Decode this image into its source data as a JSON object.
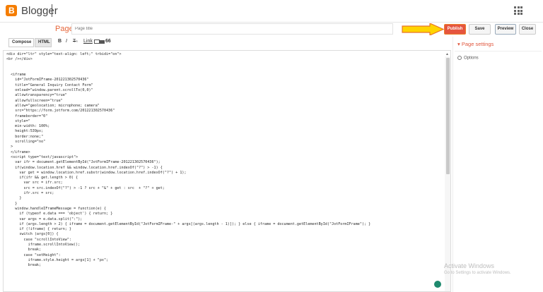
{
  "header": {
    "app_title": "Blogger",
    "logo_letter": "B"
  },
  "post": {
    "page_label": "Page",
    "title_placeholder": "Page title"
  },
  "actions": {
    "publish": "Publish",
    "save": "Save",
    "preview": "Preview",
    "close": "Close"
  },
  "toolbar": {
    "compose_tab": "Compose",
    "html_tab": "HTML",
    "bold": "B",
    "italic": "I",
    "strike": "T",
    "text_size": "₄₀",
    "link": "Link",
    "quote": "66"
  },
  "sidebar": {
    "page_settings": "Page settings",
    "options": "Options"
  },
  "editor": {
    "code": "<div dir=\"ltr\" style=\"text-align: left;\" trbidi=\"on\">\n<br /></div>\n\n\n  <iframe\n    id=\"JotFormIFrame-201221302570436\"\n    title=\"General Inquiry Contact Form\"\n    onload=\"window.parent.scrollTo(0,0)\"\n    allowtransparency=\"true\"\n    allowfullscreen=\"true\"\n    allow=\"geolocation; microphone; camera\"\n    src=\"https://form.jotform.com/201221302570436\"\n    frameborder=\"0\"\n    style=\"\n    min-width: 100%;\n    height:539px;\n    border:none;\"\n    scrolling=\"no\"\n  >\n  </iframe>\n  <script type=\"text/javascript\">\n    var ifr = document.getElementById(\"JotFormIFrame-201221302570436\");\n    if(window.location.href && window.location.href.indexOf(\"?\") > -1) {\n      var get = window.location.href.substr(window.location.href.indexOf(\"?\") + 1);\n      if(ifr && get.length > 0) {\n        var src = ifr.src;\n        src = src.indexOf(\"?\") > -1 ? src + \"&\" + get : src  + \"?\" + get;\n        ifr.src = src;\n      }\n    }\n    window.handleIFrameMessage = function(e) {\n      if (typeof e.data === 'object') { return; }\n      var args = e.data.split(\":\");\n      if (args.length > 2) { iframe = document.getElementById(\"JotFormIFrame-\" + args[(args.length - 1)]); } else { iframe = document.getElementById(\"JotFormIFrame\"); }\n      if (!iframe) { return; }\n      switch (args[0]) {\n        case \"scrollIntoView\":\n          iframe.scrollIntoView();\n          break;\n        case \"setHeight\":\n          iframe.style.height = args[1] + \"px\";\n          break;"
  },
  "watermark": {
    "title": "Activate Windows",
    "subtitle": "Go to Settings to activate Windows."
  },
  "colors": {
    "brand": "#f57d00",
    "publish": "#e5553f",
    "accent_text": "#e0573e",
    "arrow": "#ffd400"
  }
}
